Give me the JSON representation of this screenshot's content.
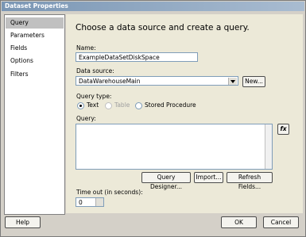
{
  "window": {
    "title": "Dataset Properties"
  },
  "sidebar": {
    "items": [
      {
        "label": "Query",
        "selected": true
      },
      {
        "label": "Parameters",
        "selected": false
      },
      {
        "label": "Fields",
        "selected": false
      },
      {
        "label": "Options",
        "selected": false
      },
      {
        "label": "Filters",
        "selected": false
      }
    ]
  },
  "main": {
    "heading": "Choose a data source and create a query.",
    "name_label": "Name:",
    "name_value": "ExampleDataSetDiskSpace",
    "datasource_label": "Data source:",
    "datasource_value": "DataWarehouseMain",
    "new_button": "New...",
    "querytype_label": "Query type:",
    "querytype_options": [
      {
        "label": "Text",
        "checked": true,
        "enabled": true
      },
      {
        "label": "Table",
        "checked": false,
        "enabled": false
      },
      {
        "label": "Stored Procedure",
        "checked": false,
        "enabled": true
      }
    ],
    "query_label": "Query:",
    "query_value": "",
    "fx_button": "fx",
    "query_designer_button": "Query Designer...",
    "import_button": "Import...",
    "refresh_fields_button": "Refresh Fields...",
    "timeout_label": "Time out (in seconds):",
    "timeout_value": "0"
  },
  "footer": {
    "help_button": "Help",
    "ok_button": "OK",
    "cancel_button": "Cancel"
  }
}
